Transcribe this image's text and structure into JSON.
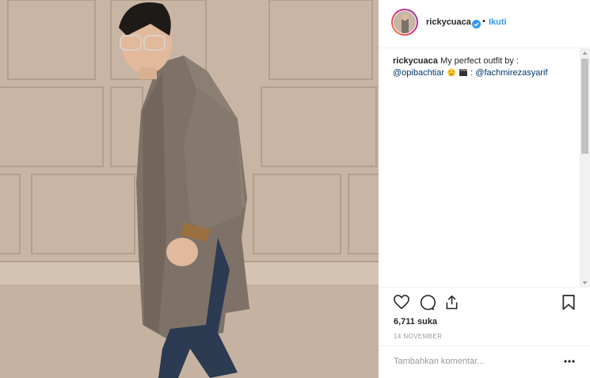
{
  "post": {
    "username": "ricky­cuaca",
    "follow_separator": "•",
    "follow_label": "Ikuti",
    "caption_user": "rickycuaca",
    "caption_text": " My perfect outfit by :",
    "mention_1": "@opibachtiar",
    "caption_sep": " : ",
    "mention_2": "@fachmirezasyarif",
    "likes": "6,711 suka",
    "date": "14 NOVEMBER",
    "comment_placeholder": "Tambahkan komentar..."
  },
  "icons": {
    "like": "heart-icon",
    "comment": "comment-bubble-icon",
    "share": "share-icon",
    "save": "bookmark-icon",
    "more": "more-dots-icon",
    "verified": "verified-badge-icon"
  },
  "colors": {
    "accent": "#3897f0",
    "mention": "#003569",
    "muted": "#999999",
    "text": "#262626"
  }
}
